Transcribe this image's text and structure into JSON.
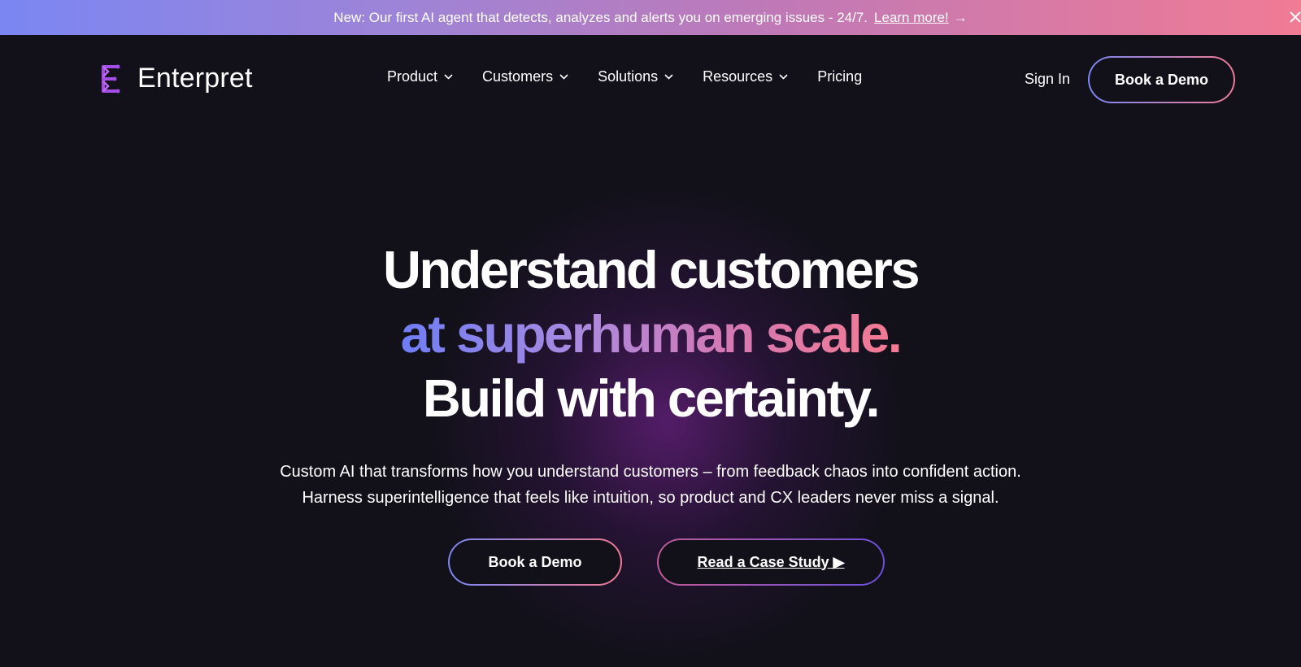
{
  "banner": {
    "text": "New: Our first AI agent that detects, analyzes and alerts you on emerging issues - 24/7.",
    "link_label": "Learn more!",
    "arrow": "→",
    "close_icon": "close-icon"
  },
  "nav": {
    "logo_text": "Enterpret",
    "logo_icon": "enterpret-logo-icon",
    "menu": [
      {
        "label": "Product",
        "has_dropdown": true
      },
      {
        "label": "Customers",
        "has_dropdown": true
      },
      {
        "label": "Solutions",
        "has_dropdown": true
      },
      {
        "label": "Resources",
        "has_dropdown": true
      },
      {
        "label": "Pricing",
        "has_dropdown": false
      }
    ],
    "sign_in_label": "Sign In",
    "demo_label": "Book a Demo"
  },
  "hero": {
    "line1": "Understand customers",
    "line2": "at superhuman scale.",
    "line3": "Build with certainty.",
    "subtitle_line1": "Custom AI that transforms how you understand customers – from feedback chaos into confident action.",
    "subtitle_line2": "Harness superintelligence that feels like intuition, so product and CX leaders never miss a signal.",
    "cta_demo_label": "Book a Demo",
    "cta_case_label": "Read a Case Study ▶"
  },
  "colors": {
    "background": "#12111a",
    "gradient_start": "#7b86f2",
    "gradient_end": "#f07b95",
    "logo_accent": "#a44ee8"
  }
}
